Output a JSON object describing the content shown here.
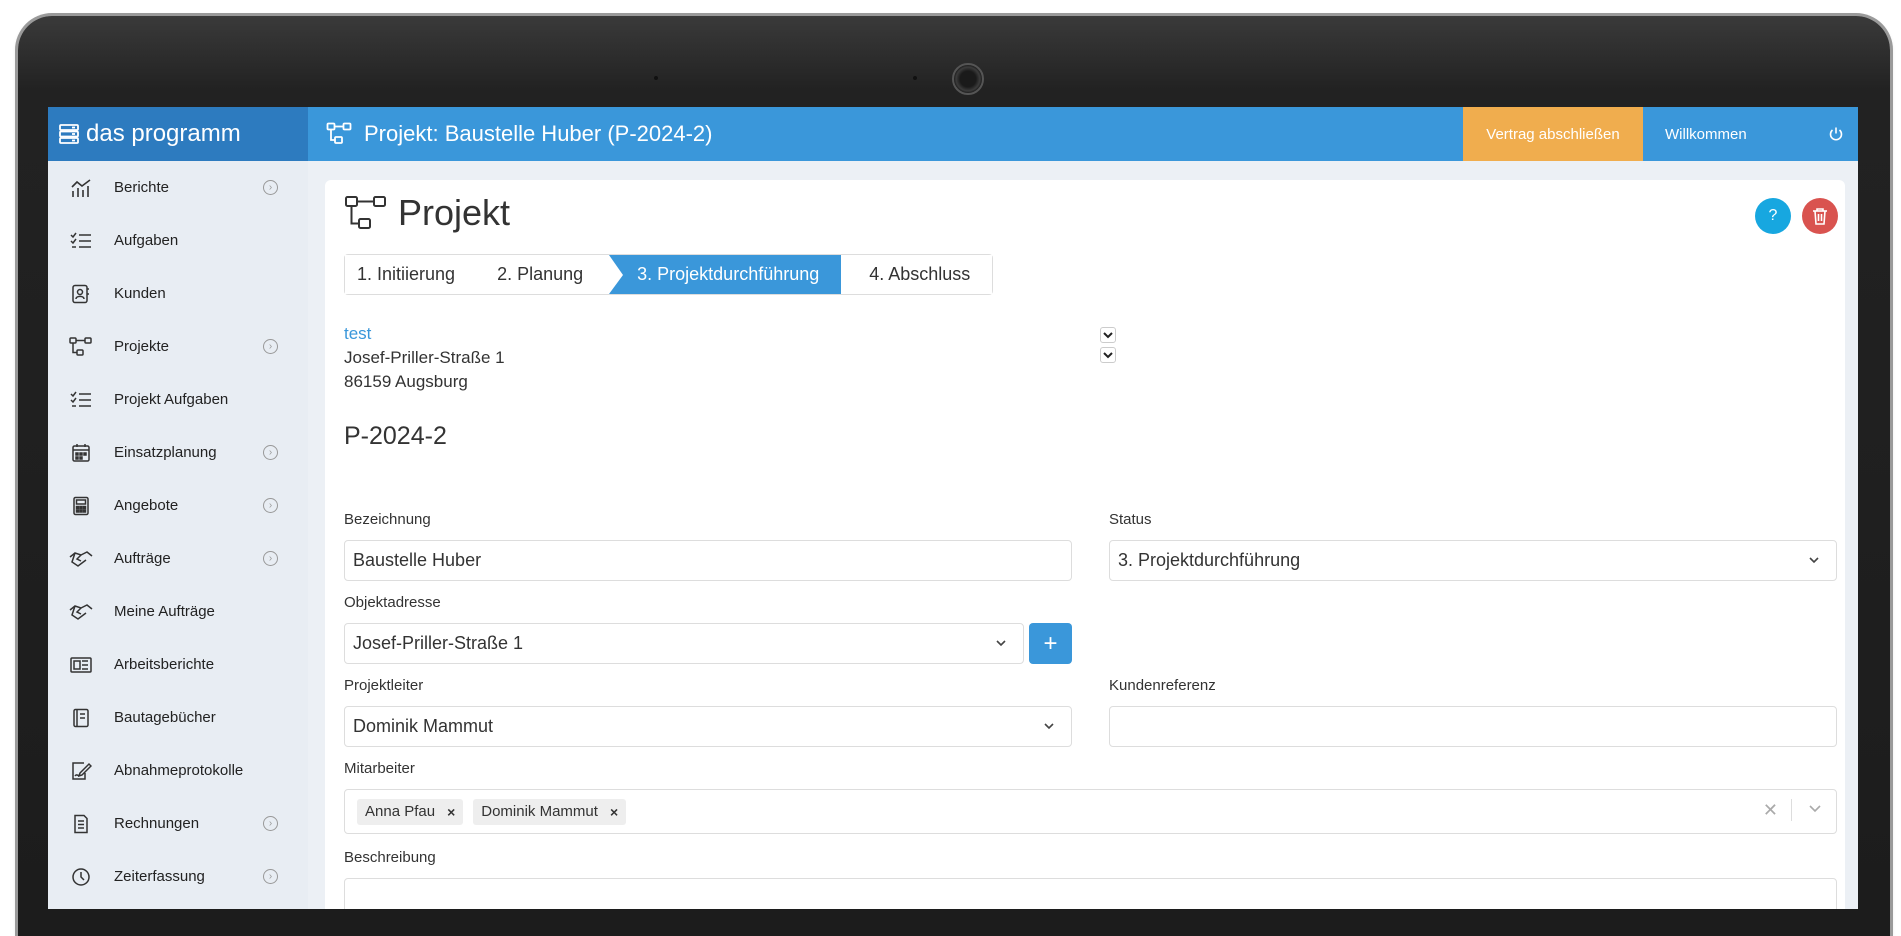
{
  "app": {
    "brand": "das programm"
  },
  "header": {
    "title": "Projekt: Baustelle Huber (P-2024-2)",
    "contract_button": "Vertrag abschließen",
    "welcome": "Willkommen"
  },
  "sidebar": {
    "items": [
      {
        "label": "Berichte",
        "icon": "chart-icon",
        "expandable": true
      },
      {
        "label": "Aufgaben",
        "icon": "checklist-icon",
        "expandable": false
      },
      {
        "label": "Kunden",
        "icon": "contact-icon",
        "expandable": false
      },
      {
        "label": "Projekte",
        "icon": "project-icon",
        "expandable": true
      },
      {
        "label": "Projekt Aufgaben",
        "icon": "checklist-icon",
        "expandable": false
      },
      {
        "label": "Einsatzplanung",
        "icon": "calendar-icon",
        "expandable": true
      },
      {
        "label": "Angebote",
        "icon": "calculator-icon",
        "expandable": true
      },
      {
        "label": "Aufträge",
        "icon": "handshake-icon",
        "expandable": true
      },
      {
        "label": "Meine Aufträge",
        "icon": "handshake-icon",
        "expandable": false
      },
      {
        "label": "Arbeitsberichte",
        "icon": "report-icon",
        "expandable": false
      },
      {
        "label": "Bautagebücher",
        "icon": "book-icon",
        "expandable": false
      },
      {
        "label": "Abnahmeprotokolle",
        "icon": "sign-icon",
        "expandable": false
      },
      {
        "label": "Rechnungen",
        "icon": "invoice-icon",
        "expandable": true
      },
      {
        "label": "Zeiterfassung",
        "icon": "clock-icon",
        "expandable": true
      }
    ]
  },
  "main": {
    "title": "Projekt",
    "help_label": "?",
    "steps": [
      "1. Initiierung",
      "2. Planung",
      "3. Projektdurchführung",
      "4. Abschluss"
    ],
    "active_step": 2,
    "customer": {
      "name": "test",
      "street": "Josef-Priller-Straße 1",
      "city": "86159 Augsburg"
    },
    "project_number": "P-2024-2",
    "form": {
      "bezeichnung_label": "Bezeichnung",
      "bezeichnung_value": "Baustelle Huber",
      "status_label": "Status",
      "status_value": "3. Projektdurchführung",
      "objektadresse_label": "Objektadresse",
      "objektadresse_value": "Josef-Priller-Straße 1",
      "add_label": "+",
      "projektleiter_label": "Projektleiter",
      "projektleiter_value": "Dominik Mammut",
      "kundenreferenz_label": "Kundenreferenz",
      "kundenreferenz_value": "",
      "mitarbeiter_label": "Mitarbeiter",
      "mitarbeiter": [
        "Anna Pfau",
        "Dominik Mammut"
      ],
      "beschreibung_label": "Beschreibung",
      "beschreibung_value": ""
    }
  },
  "colors": {
    "primary": "#3a97da",
    "brand": "#2d7bbf",
    "warning": "#f0ad4e",
    "danger": "#d9534f",
    "info": "#17a7e0"
  }
}
